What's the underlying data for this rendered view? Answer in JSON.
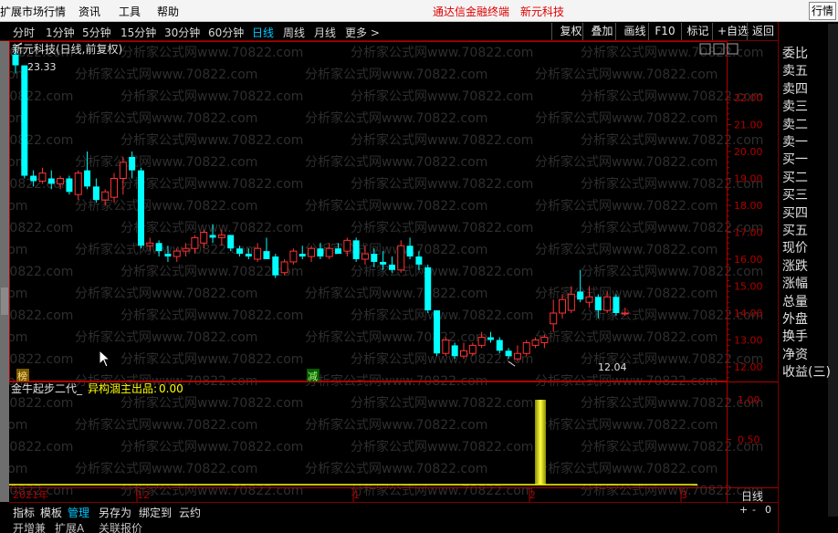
{
  "menubar": {
    "items": [
      "扩展市场行情",
      "资讯",
      "工具",
      "帮助"
    ],
    "brand": "通达信金融终端",
    "stock": "新元科技",
    "right_button": "行情"
  },
  "toolbar": {
    "periods": [
      "分时",
      "1分钟",
      "5分钟",
      "15分钟",
      "30分钟",
      "60分钟",
      "日线",
      "周线",
      "月线",
      "更多 >"
    ],
    "active_period": "日线",
    "buttons": [
      "复权",
      "叠加",
      "画线",
      "F10",
      "标记",
      "+自选",
      "返回"
    ]
  },
  "right_panel": {
    "items": [
      "委比",
      "卖五",
      "卖四",
      "卖三",
      "卖二",
      "卖一",
      "买一",
      "买二",
      "买三",
      "买四",
      "买五",
      "现价",
      "涨跌",
      "涨幅",
      "总量",
      "外盘",
      "换手",
      "净资",
      "收益(三)"
    ]
  },
  "chart": {
    "stock_label": "新元科技(日线,前复权)",
    "high_label": "23.33",
    "low_label": "12.04",
    "badge_left": "榜",
    "badge_mid": "减",
    "indicator_title": "金牛起步二代_",
    "indicator_name": "异构涸主出品:",
    "indicator_value": "0.00",
    "x_labels": [
      "2021年",
      "12",
      "1",
      "2",
      "3"
    ],
    "watermark": "分析家公式网www.70822.com"
  },
  "chart_data": {
    "type": "candlestick",
    "price_axis": [
      22.0,
      21.0,
      20.0,
      19.0,
      18.0,
      17.0,
      16.0,
      15.0,
      14.0,
      13.0,
      12.0
    ],
    "indicator_axis": [
      1.0,
      0.5
    ],
    "candles": [
      [
        23.6,
        23.9,
        22.9,
        23.2
      ],
      [
        23.2,
        23.2,
        19.0,
        19.1
      ],
      [
        19.1,
        19.3,
        18.7,
        18.9
      ],
      [
        18.9,
        19.4,
        18.8,
        19.2
      ],
      [
        19.0,
        19.3,
        18.6,
        18.8
      ],
      [
        18.8,
        19.1,
        18.6,
        19.0
      ],
      [
        19.0,
        19.1,
        18.4,
        18.5
      ],
      [
        18.4,
        19.3,
        18.2,
        19.2
      ],
      [
        19.3,
        20.0,
        18.6,
        18.7
      ],
      [
        18.7,
        19.0,
        18.1,
        18.2
      ],
      [
        18.2,
        18.6,
        18.0,
        18.5
      ],
      [
        18.3,
        19.2,
        18.1,
        19.0
      ],
      [
        19.0,
        19.8,
        18.4,
        19.6
      ],
      [
        19.8,
        20.0,
        19.0,
        19.3
      ],
      [
        19.3,
        19.4,
        16.4,
        16.5
      ],
      [
        16.5,
        16.8,
        16.3,
        16.6
      ],
      [
        16.6,
        16.7,
        16.1,
        16.3
      ],
      [
        16.2,
        16.5,
        15.9,
        16.1
      ],
      [
        16.1,
        16.4,
        15.9,
        16.3
      ],
      [
        16.3,
        16.6,
        16.1,
        16.4
      ],
      [
        16.4,
        16.9,
        16.2,
        16.8
      ],
      [
        16.6,
        17.1,
        16.4,
        17.0
      ],
      [
        16.9,
        17.3,
        16.6,
        16.8
      ],
      [
        16.8,
        17.1,
        16.5,
        16.9
      ],
      [
        16.9,
        16.9,
        16.3,
        16.4
      ],
      [
        16.4,
        16.5,
        16.1,
        16.2
      ],
      [
        16.2,
        16.4,
        16.0,
        16.1
      ],
      [
        16.0,
        16.6,
        15.9,
        16.4
      ],
      [
        16.3,
        16.8,
        16.1,
        16.0
      ],
      [
        16.1,
        16.2,
        15.3,
        15.4
      ],
      [
        15.5,
        16.0,
        15.4,
        15.9
      ],
      [
        15.9,
        16.4,
        15.8,
        16.3
      ],
      [
        16.2,
        16.5,
        16.0,
        16.1
      ],
      [
        16.1,
        16.5,
        15.9,
        16.4
      ],
      [
        16.4,
        16.6,
        16.0,
        16.1
      ],
      [
        16.1,
        16.6,
        16.0,
        16.4
      ],
      [
        16.4,
        16.6,
        16.2,
        16.2
      ],
      [
        16.3,
        16.8,
        16.1,
        16.7
      ],
      [
        16.7,
        16.8,
        15.9,
        16.0
      ],
      [
        16.0,
        16.5,
        15.8,
        16.2
      ],
      [
        16.2,
        16.4,
        15.7,
        15.9
      ],
      [
        15.9,
        16.3,
        15.6,
        15.8
      ],
      [
        15.8,
        16.1,
        15.5,
        15.6
      ],
      [
        15.6,
        16.7,
        15.5,
        16.5
      ],
      [
        16.5,
        16.8,
        16.0,
        16.1
      ],
      [
        16.1,
        16.3,
        15.6,
        15.8
      ],
      [
        15.7,
        15.8,
        14.0,
        14.1
      ],
      [
        14.1,
        14.1,
        12.4,
        12.5
      ],
      [
        12.5,
        13.1,
        12.4,
        13.0
      ],
      [
        12.8,
        12.9,
        12.3,
        12.4
      ],
      [
        12.4,
        12.9,
        12.3,
        12.6
      ],
      [
        12.5,
        12.9,
        12.4,
        12.8
      ],
      [
        12.8,
        13.3,
        12.7,
        13.1
      ],
      [
        13.1,
        13.3,
        12.9,
        13.0
      ],
      [
        13.0,
        13.1,
        12.5,
        12.6
      ],
      [
        12.6,
        12.7,
        12.3,
        12.4
      ],
      [
        12.3,
        12.8,
        12.2,
        12.5
      ],
      [
        12.5,
        13.0,
        12.4,
        12.9
      ],
      [
        12.8,
        13.1,
        12.7,
        13.0
      ],
      [
        12.9,
        13.2,
        12.7,
        13.1
      ],
      [
        13.6,
        14.5,
        13.3,
        14.0
      ],
      [
        14.0,
        14.7,
        13.8,
        14.5
      ],
      [
        14.1,
        15.0,
        14.0,
        14.7
      ],
      [
        14.8,
        15.6,
        14.4,
        14.5
      ],
      [
        14.4,
        15.0,
        14.2,
        14.6
      ],
      [
        14.6,
        14.7,
        13.8,
        14.1
      ],
      [
        14.1,
        14.8,
        14.0,
        14.6
      ],
      [
        14.6,
        14.7,
        13.9,
        14.0
      ],
      [
        14.0,
        14.2,
        13.9,
        14.0
      ]
    ],
    "indicator_bar": {
      "index": 47,
      "value": 1.0
    }
  },
  "bottom": {
    "tabs": [
      "指标",
      "模板",
      "管理",
      "另存为",
      "绑定到",
      "云约"
    ],
    "active_tab": "管理",
    "sub_items": [
      "开增兼",
      "扩展A",
      "关联报价"
    ],
    "period_label": "日线",
    "zoom": [
      "+",
      "-",
      "0"
    ]
  },
  "colors": {
    "up": "#ff3232",
    "down": "#00ffff",
    "axis": "#b00000",
    "indicator": "#ffff00"
  }
}
